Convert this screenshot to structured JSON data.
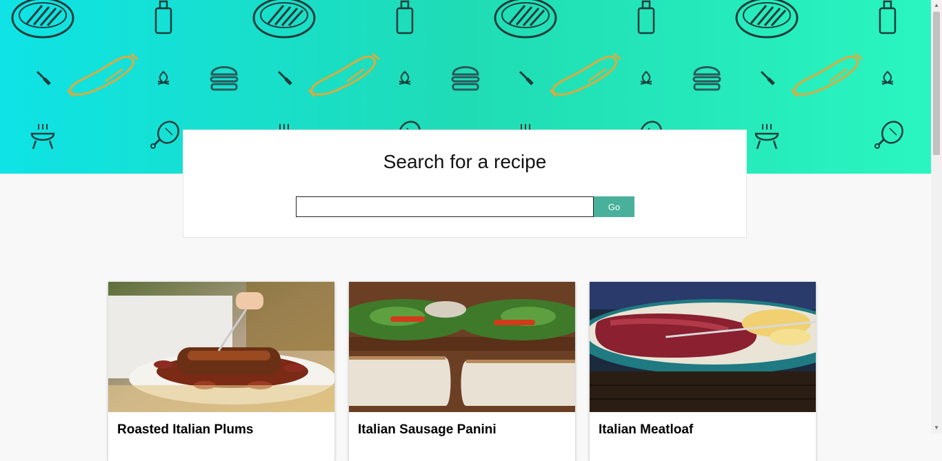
{
  "hero": {
    "icons": [
      "steak-icon",
      "sauce-bottle-icon",
      "knife-icon",
      "sausage-icon",
      "campfire-icon",
      "burger-icon",
      "grill-icon",
      "drumstick-icon"
    ]
  },
  "search": {
    "title": "Search for a recipe",
    "input_value": "",
    "placeholder": "",
    "go_label": "Go"
  },
  "recipes": [
    {
      "title": "Roasted Italian Plums"
    },
    {
      "title": "Italian Sausage Panini"
    },
    {
      "title": "Italian Meatloaf"
    }
  ],
  "colors": {
    "hero_start": "#0fe3e6",
    "hero_end": "#2af5c0",
    "icon_dark": "#1d3b3b",
    "icon_accent": "#e0a93a",
    "go_button": "#48b09b",
    "page_background": "#f8f8f8"
  }
}
